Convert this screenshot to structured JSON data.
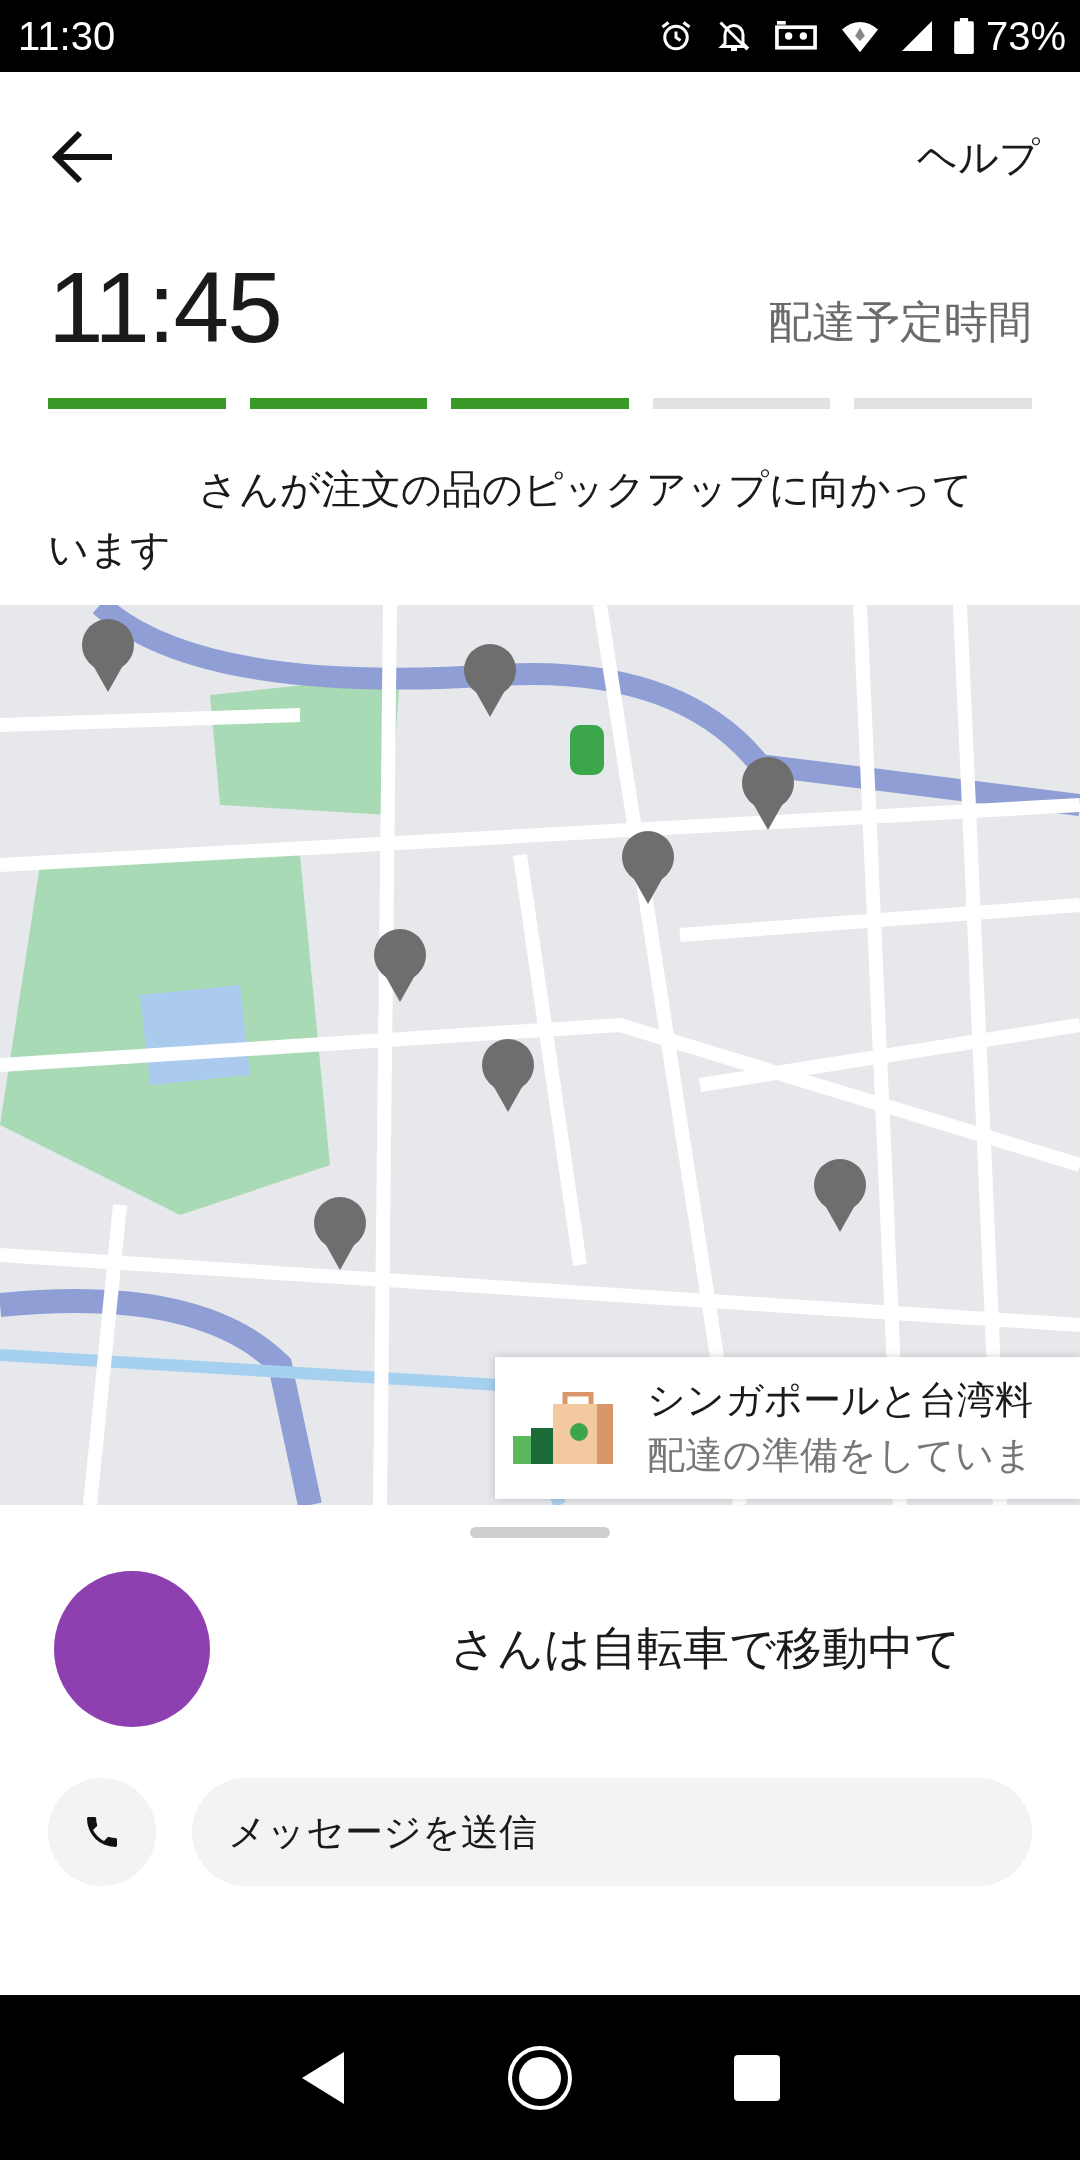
{
  "status_bar": {
    "time": "11:30",
    "battery": "73%"
  },
  "header": {
    "help": "ヘルプ"
  },
  "eta": {
    "time": "11:45",
    "label": "配達予定時間"
  },
  "progress": [
    {
      "filled": true
    },
    {
      "filled": true
    },
    {
      "filled": true
    },
    {
      "filled": false
    },
    {
      "filled": false
    }
  ],
  "status_message": "さんが注文の品のピックアップに向かっています",
  "map_card": {
    "title": "シンガポールと台湾料",
    "subtitle": "配達の準備をしていま"
  },
  "courier": {
    "message": "さんは自転車で移動中て"
  },
  "actions": {
    "message_placeholder": "メッセージを送信"
  }
}
